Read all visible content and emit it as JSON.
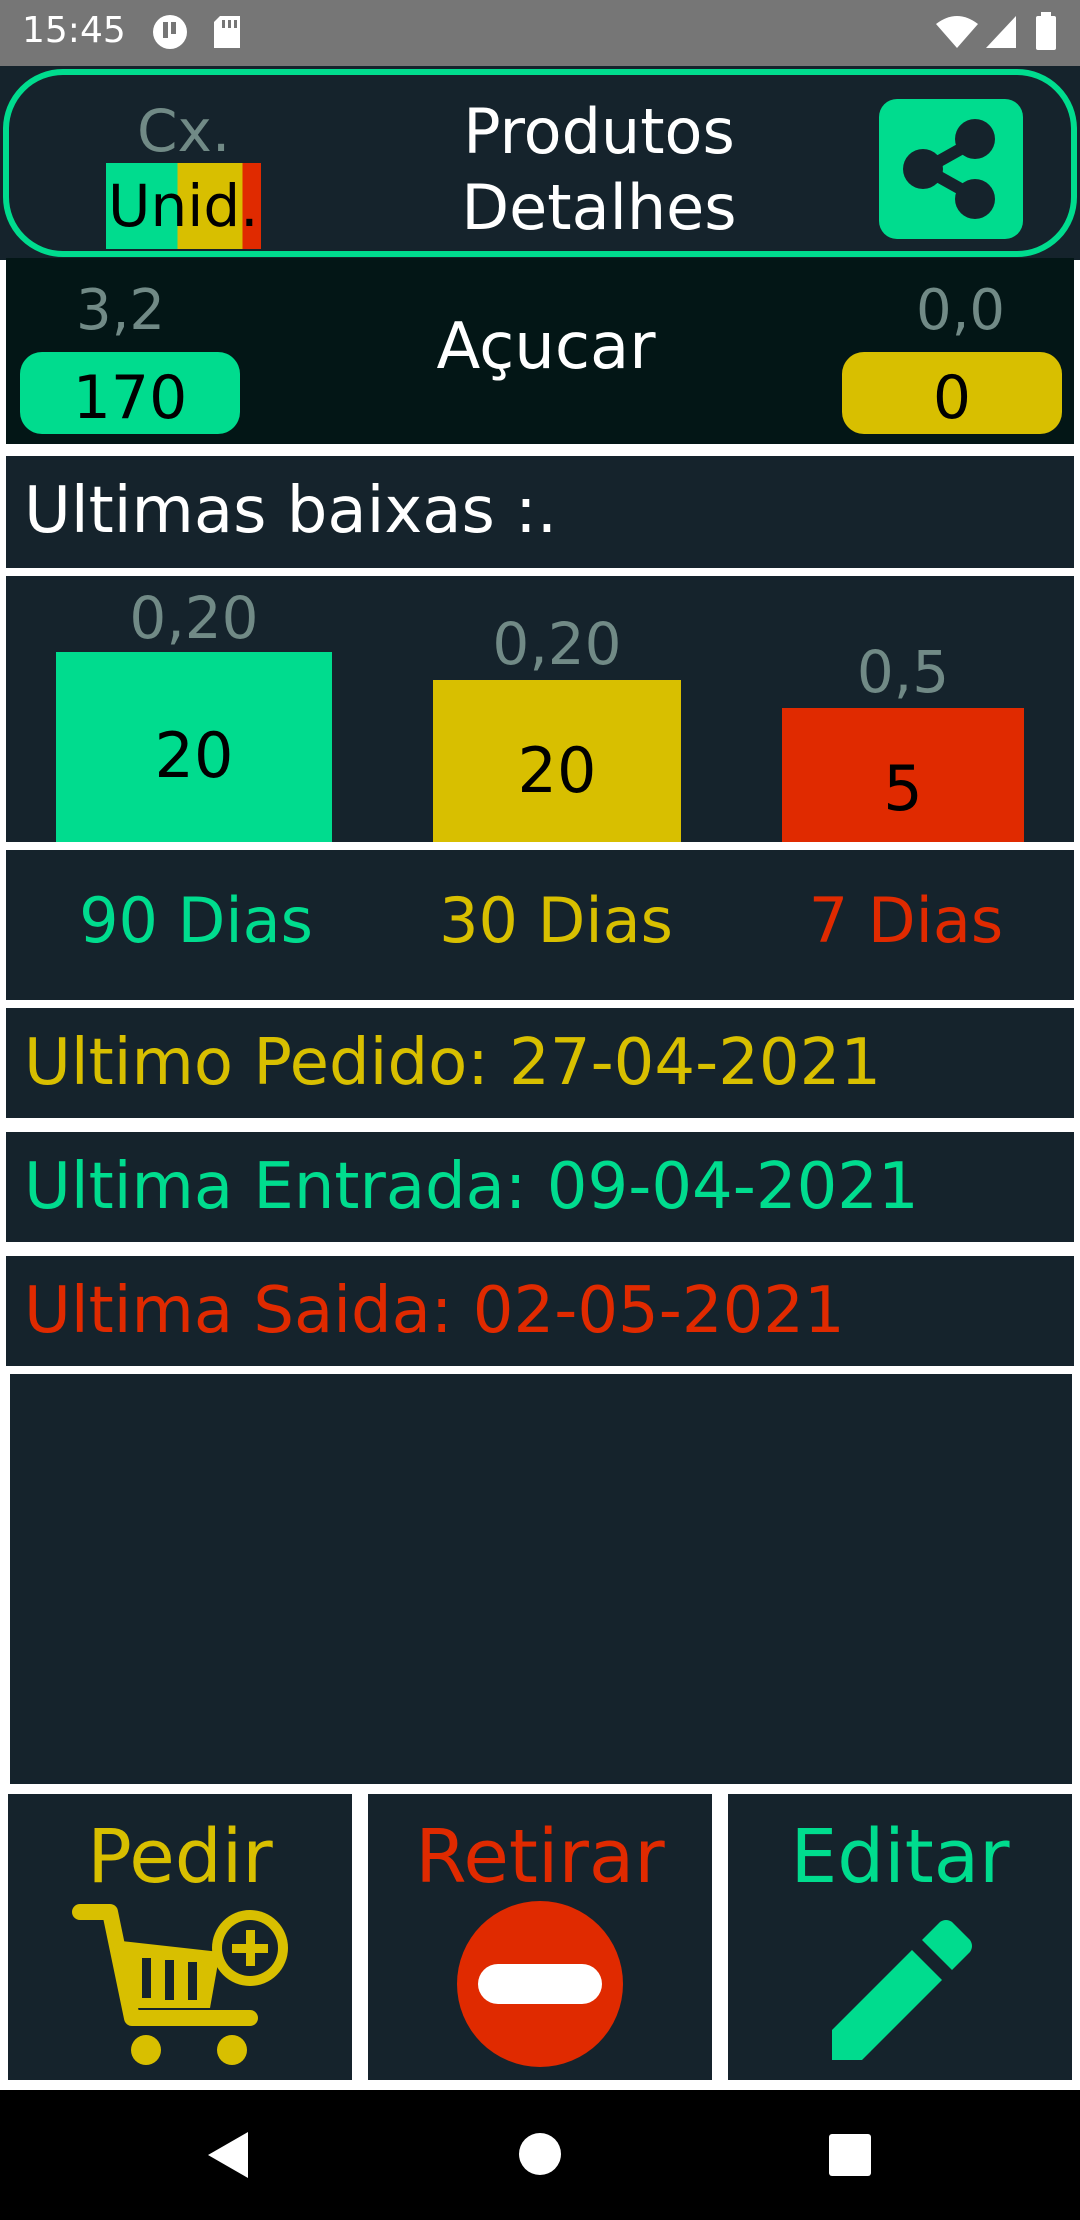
{
  "status_bar": {
    "time": "15:45"
  },
  "header": {
    "unit_top": "Cx.",
    "unit_bottom": "Unid.",
    "title_line1": "Produtos",
    "title_line2": "Detalhes",
    "share_icon": "share-icon"
  },
  "product": {
    "left_small": "3,2",
    "left_value": "170",
    "name": "Açucar",
    "right_small": "0,0",
    "right_value": "0"
  },
  "section_title": "Ultimas baixas :.",
  "bars": [
    {
      "top": "0,20",
      "value": "20",
      "color": "#00dc8e"
    },
    {
      "top": "0,20",
      "value": "20",
      "color": "#d8bf00"
    },
    {
      "top": "0,5",
      "value": "5",
      "color": "#e02a00"
    }
  ],
  "periods": [
    {
      "label": "90 Dias",
      "color": "#00dc8e"
    },
    {
      "label": "30 Dias",
      "color": "#d8bf00"
    },
    {
      "label": "7 Dias",
      "color": "#e02a00"
    }
  ],
  "last_order": "Ultimo Pedido: 27-04-2021",
  "last_entry": "Ultima Entrada: 09-04-2021",
  "last_exit": "Ultima Saida: 02-05-2021",
  "actions": {
    "order": {
      "label": "Pedir",
      "icon": "cart-plus-icon"
    },
    "withdraw": {
      "label": "Retirar",
      "icon": "minus-circle-icon"
    },
    "edit": {
      "label": "Editar",
      "icon": "pencil-icon"
    }
  },
  "colors": {
    "accent_green": "#00dc8e",
    "accent_yellow": "#d8bf00",
    "accent_red": "#e02a00",
    "panel_bg": "#15232c",
    "muted_text": "#718a86"
  }
}
